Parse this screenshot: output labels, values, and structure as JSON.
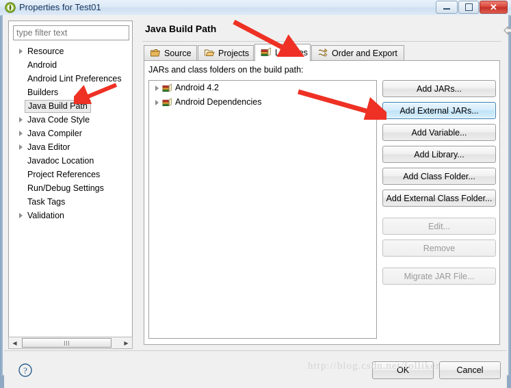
{
  "window": {
    "title": "Properties for Test01",
    "app_icon": "eclipse-icon",
    "controls": {
      "minimize": "minimize-button",
      "maximize": "maximize-button",
      "close": "close-button",
      "close_glyph": "✕"
    }
  },
  "sidebar": {
    "filter": {
      "value": "",
      "placeholder": "type filter text"
    },
    "items": [
      {
        "label": "Resource",
        "expandable": true,
        "selected": false
      },
      {
        "label": "Android",
        "expandable": false,
        "selected": false
      },
      {
        "label": "Android Lint Preferences",
        "expandable": false,
        "selected": false
      },
      {
        "label": "Builders",
        "expandable": false,
        "selected": false
      },
      {
        "label": "Java Build Path",
        "expandable": false,
        "selected": true
      },
      {
        "label": "Java Code Style",
        "expandable": true,
        "selected": false
      },
      {
        "label": "Java Compiler",
        "expandable": true,
        "selected": false
      },
      {
        "label": "Java Editor",
        "expandable": true,
        "selected": false
      },
      {
        "label": "Javadoc Location",
        "expandable": false,
        "selected": false
      },
      {
        "label": "Project References",
        "expandable": false,
        "selected": false
      },
      {
        "label": "Run/Debug Settings",
        "expandable": false,
        "selected": false
      },
      {
        "label": "Task Tags",
        "expandable": false,
        "selected": false
      },
      {
        "label": "Validation",
        "expandable": true,
        "selected": false
      }
    ],
    "scrollbar": {
      "left_arrow": "◀",
      "right_arrow": "▶"
    }
  },
  "page": {
    "title": "Java Build Path",
    "nav": {
      "back": "back-arrow-icon",
      "back_menu": "back-dropdown-icon",
      "forward": "forward-arrow-icon",
      "forward_menu": "forward-dropdown-icon",
      "menu": "view-menu-icon"
    },
    "tabs": [
      {
        "label": "Source",
        "icon": "source-folder-icon",
        "active": false
      },
      {
        "label": "Projects",
        "icon": "open-folder-icon",
        "active": false
      },
      {
        "label": "Libraries",
        "icon": "library-books-icon",
        "active": true
      },
      {
        "label": "Order and Export",
        "icon": "order-export-icon",
        "active": false
      }
    ],
    "libraries": {
      "description": "JARs and class folders on the build path:",
      "entries": [
        {
          "label": "Android 4.2",
          "icon": "library-books-icon",
          "expandable": true
        },
        {
          "label": "Android Dependencies",
          "icon": "library-books-icon",
          "expandable": true
        }
      ]
    },
    "buttons": [
      {
        "label": "Add JARs...",
        "state": "normal"
      },
      {
        "label": "Add External JARs...",
        "state": "focused"
      },
      {
        "label": "Add Variable...",
        "state": "normal"
      },
      {
        "label": "Add Library...",
        "state": "normal"
      },
      {
        "label": "Add Class Folder...",
        "state": "normal"
      },
      {
        "label": "Add External Class Folder...",
        "state": "normal"
      },
      {
        "label": "Edit...",
        "state": "disabled"
      },
      {
        "label": "Remove",
        "state": "disabled"
      },
      {
        "label": "Migrate JAR File...",
        "state": "disabled"
      }
    ]
  },
  "footer": {
    "help": "help-icon",
    "ok": "OK",
    "cancel": "Cancel"
  },
  "watermark": {
    "text": "http://blog.csdn.net/folliker"
  },
  "annotations": {
    "arrow_to_libraries_tab": "red-arrow-annotation",
    "arrow_to_java_build_path": "red-arrow-annotation",
    "arrow_to_add_external_jars": "red-arrow-annotation"
  },
  "colors": {
    "accent_blue": "#3c7fb1",
    "annotation_red": "#ee3124",
    "title_text": "#14325c",
    "dialog_bg": "#f0f0f0"
  }
}
